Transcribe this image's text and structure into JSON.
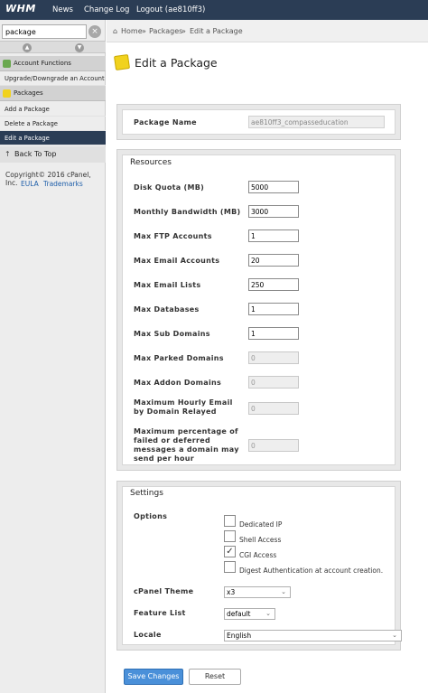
{
  "topbar": {
    "logo": "WHM",
    "nav": [
      "News",
      "Change Log",
      "Logout (ae810ff3)"
    ]
  },
  "sidebar": {
    "search_value": "package",
    "clear_glyph": "×",
    "up_glyph": "▲",
    "down_glyph": "▼",
    "account_functions": "Account Functions",
    "upgrade_downgrade": "Upgrade/Downgrade an Account",
    "packages": "Packages",
    "items": [
      "Add a Package",
      "Delete a Package",
      "Edit a Package"
    ],
    "back_to_top": "Back To Top",
    "back_arrow": "↑",
    "copyright": "Copyright© 2016 cPanel, Inc.",
    "eula": "EULA",
    "trademarks": "Trademarks"
  },
  "breadcrumb": {
    "home": "Home",
    "sep": "»",
    "packages": "Packages",
    "current": "Edit a Package"
  },
  "page": {
    "title": "Edit a Package"
  },
  "package_name": {
    "label": "Package Name",
    "value": "ae810ff3_compasseducation"
  },
  "resources": {
    "title": "Resources",
    "rows": [
      {
        "label": "Disk Quota (MB)",
        "value": "5000"
      },
      {
        "label": "Monthly Bandwidth (MB)",
        "value": "3000"
      },
      {
        "label": "Max FTP Accounts",
        "value": "1"
      },
      {
        "label": "Max Email Accounts",
        "value": "20"
      },
      {
        "label": "Max Email Lists",
        "value": "250"
      },
      {
        "label": "Max Databases",
        "value": "1"
      },
      {
        "label": "Max Sub Domains",
        "value": "1"
      },
      {
        "label": "Max Parked Domains",
        "value": "0"
      },
      {
        "label": "Max Addon Domains",
        "value": "0"
      },
      {
        "label": "Maximum Hourly Email by Domain Relayed",
        "value": "0"
      },
      {
        "label": "Maximum percentage of failed or deferred messages a domain may send per hour",
        "value": "0"
      }
    ]
  },
  "settings": {
    "title": "Settings",
    "options_label": "Options",
    "options": [
      {
        "label": "Dedicated IP",
        "checked": false
      },
      {
        "label": "Shell Access",
        "checked": false
      },
      {
        "label": "CGI Access",
        "checked": true
      },
      {
        "label": "Digest Authentication at account creation.",
        "checked": false
      }
    ],
    "check_glyph": "✓",
    "cpanel_theme_label": "cPanel Theme",
    "cpanel_theme_value": "x3",
    "feature_list_label": "Feature List",
    "feature_list_value": "default",
    "locale_label": "Locale",
    "locale_value": "English",
    "chevron_glyph": "⌄"
  },
  "buttons": {
    "save": "Save Changes",
    "reset": "Reset"
  },
  "colors": {
    "topbar": "#2b3d55",
    "active_item": "#2b3d55",
    "save_button": "#4a90d9",
    "page_icon": "#f1d21e"
  }
}
